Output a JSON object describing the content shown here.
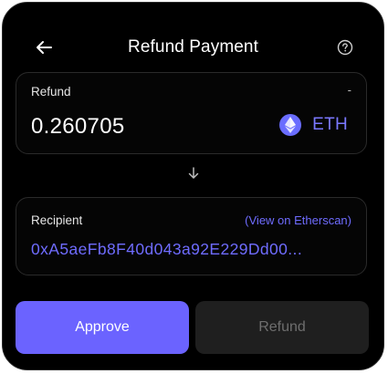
{
  "header": {
    "title": "Refund Payment",
    "back_icon": "arrow-left-icon",
    "help_icon": "question-circle-icon"
  },
  "amount_card": {
    "label": "Refund",
    "dash": "-",
    "value": "0.260705",
    "token_symbol": "ETH",
    "token_icon": "ethereum-icon"
  },
  "divider_icon": "arrow-down-icon",
  "recipient_card": {
    "label": "Recipient",
    "link_text": "(View on Etherscan)",
    "address": "0xA5aeFb8F40d043a92E229Dd00..."
  },
  "actions": {
    "approve_label": "Approve",
    "refund_label": "Refund"
  },
  "colors": {
    "accent": "#6b63ff",
    "link": "#6f6cff",
    "background": "#000000",
    "disabled_button": "#1f1f1f"
  }
}
